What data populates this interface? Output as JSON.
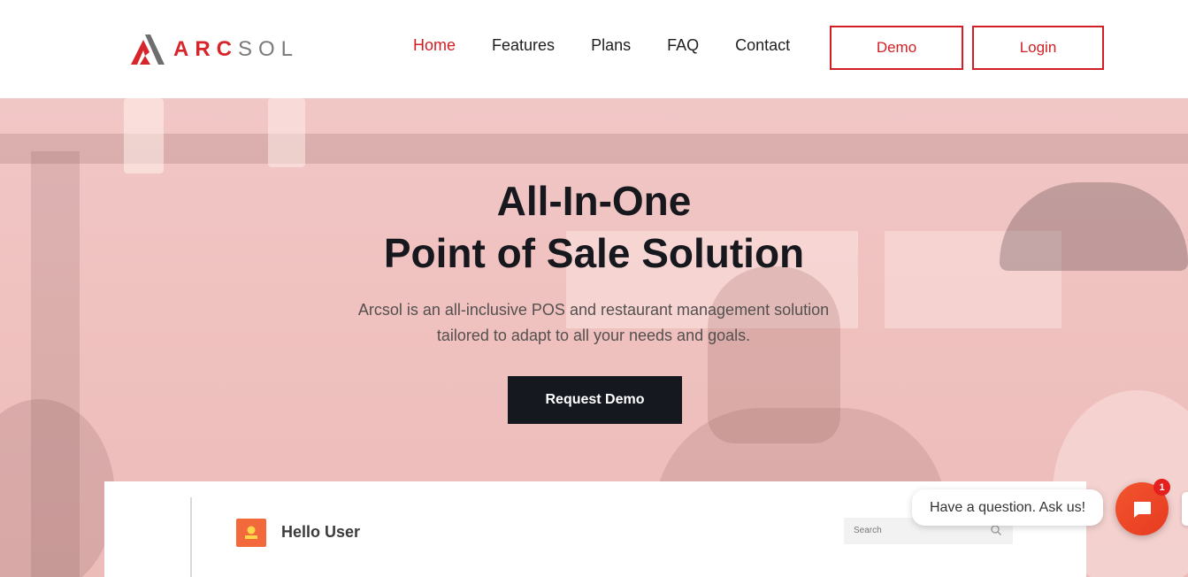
{
  "logo": {
    "red": "ARC",
    "gray": "SOL",
    "icon": "arcsol-logo-icon"
  },
  "nav": {
    "items": [
      "Home",
      "Features",
      "Plans",
      "FAQ",
      "Contact"
    ],
    "active": "Home"
  },
  "header_buttons": {
    "demo": "Demo",
    "login": "Login"
  },
  "hero": {
    "title_line1": "All-In-One",
    "title_line2": "Point of Sale Solution",
    "subtitle_line1": "Arcsol is an all-inclusive POS and restaurant management solution",
    "subtitle_line2": "tailored to adapt to all your needs and goals.",
    "cta": "Request Demo"
  },
  "preview": {
    "greeting": "Hello User",
    "search_placeholder": "Search",
    "user_icon": "user-icon",
    "search_icon": "search-icon"
  },
  "chat": {
    "prompt": "Have a question. Ask us!",
    "badge": "1",
    "icon": "chat-icon"
  },
  "colors": {
    "brand_red": "#d02026",
    "dark": "#15191f",
    "hero_tint": "#f1c7c6",
    "chat_orange": "#f2552f"
  }
}
